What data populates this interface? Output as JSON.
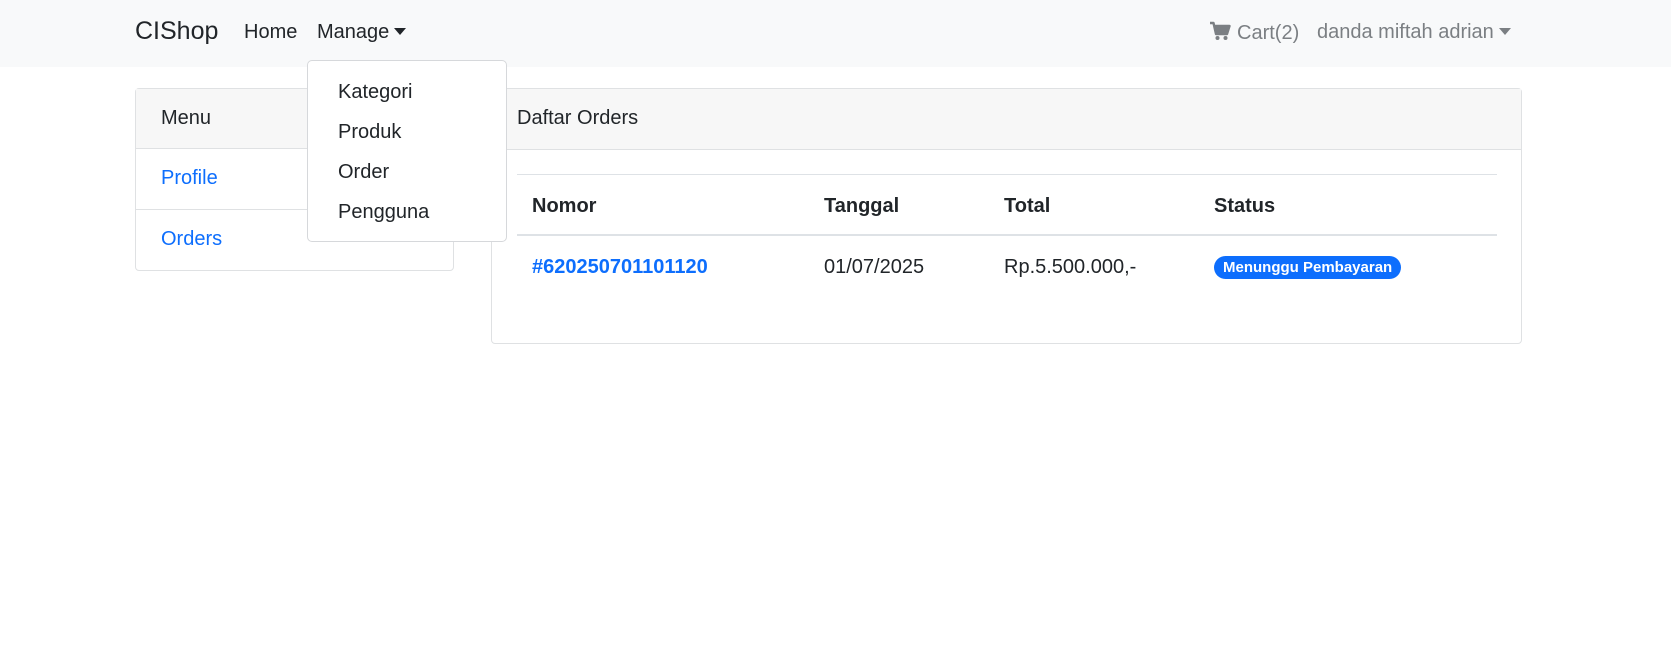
{
  "navbar": {
    "brand": "CIShop",
    "home": "Home",
    "manage": "Manage",
    "cart": "Cart(2)",
    "user": "danda miftah adrian"
  },
  "manage_menu": {
    "items": [
      "Kategori",
      "Produk",
      "Order",
      "Pengguna"
    ]
  },
  "sidebar": {
    "title": "Menu",
    "items": [
      "Profile",
      "Orders"
    ]
  },
  "orders": {
    "title": "Daftar Orders",
    "columns": [
      "Nomor",
      "Tanggal",
      "Total",
      "Status"
    ],
    "rows": [
      {
        "nomor": "#620250701101120",
        "tanggal": "01/07/2025",
        "total": "Rp.5.500.000,-",
        "status": "Menunggu Pembayaran"
      }
    ]
  },
  "colors": {
    "primary": "#0d6efd",
    "navbar_bg": "#f8f9fa",
    "muted": "#7b7f83"
  },
  "icons": {
    "cart": "shopping-cart-icon",
    "caret": "caret-down-icon"
  }
}
